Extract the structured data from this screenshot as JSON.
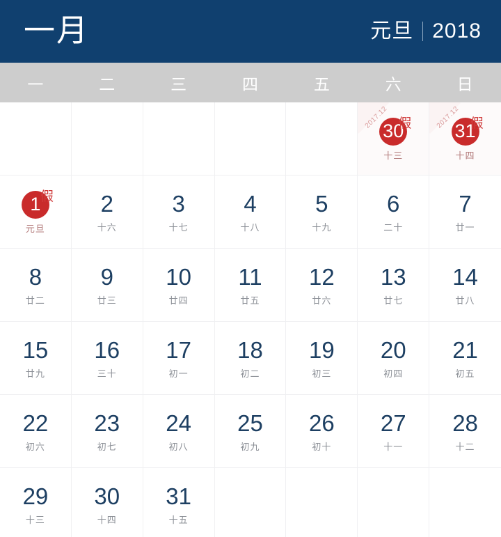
{
  "header": {
    "month_label": "一月",
    "festival_label": "元旦",
    "year_label": "2018",
    "background_color": "#10406f",
    "text_color": "#ffffff"
  },
  "weekdays": {
    "background_color": "#cdcdcd",
    "items": [
      {
        "label": "一"
      },
      {
        "label": "二"
      },
      {
        "label": "三"
      },
      {
        "label": "四"
      },
      {
        "label": "五"
      },
      {
        "label": "六"
      },
      {
        "label": "日"
      }
    ]
  },
  "colors": {
    "navy": "#10406f",
    "day_number": "#1d3f62",
    "lunar_text": "#8b8f96",
    "holiday_red": "#c92b2b",
    "holiday_badge_red": "#cf3b3b",
    "corner_tag_text": "#d99a9a",
    "grid_line": "#eff0f2"
  },
  "weeks": [
    [
      {
        "empty": true
      },
      {
        "empty": true
      },
      {
        "empty": true
      },
      {
        "empty": true
      },
      {
        "empty": true
      },
      {
        "day": "30",
        "lunar": "十三",
        "holiday": true,
        "badge": "假",
        "corner_tag": "2017.12",
        "prev_month": true
      },
      {
        "day": "31",
        "lunar": "十四",
        "holiday": true,
        "badge": "假",
        "corner_tag": "2017.12",
        "prev_month": true
      }
    ],
    [
      {
        "day": "1",
        "lunar": "元旦",
        "holiday": true,
        "badge": "假"
      },
      {
        "day": "2",
        "lunar": "十六"
      },
      {
        "day": "3",
        "lunar": "十七"
      },
      {
        "day": "4",
        "lunar": "十八"
      },
      {
        "day": "5",
        "lunar": "十九"
      },
      {
        "day": "6",
        "lunar": "二十"
      },
      {
        "day": "7",
        "lunar": "廿一"
      }
    ],
    [
      {
        "day": "8",
        "lunar": "廿二"
      },
      {
        "day": "9",
        "lunar": "廿三"
      },
      {
        "day": "10",
        "lunar": "廿四"
      },
      {
        "day": "11",
        "lunar": "廿五"
      },
      {
        "day": "12",
        "lunar": "廿六"
      },
      {
        "day": "13",
        "lunar": "廿七"
      },
      {
        "day": "14",
        "lunar": "廿八"
      }
    ],
    [
      {
        "day": "15",
        "lunar": "廿九"
      },
      {
        "day": "16",
        "lunar": "三十"
      },
      {
        "day": "17",
        "lunar": "初一"
      },
      {
        "day": "18",
        "lunar": "初二"
      },
      {
        "day": "19",
        "lunar": "初三"
      },
      {
        "day": "20",
        "lunar": "初四"
      },
      {
        "day": "21",
        "lunar": "初五"
      }
    ],
    [
      {
        "day": "22",
        "lunar": "初六"
      },
      {
        "day": "23",
        "lunar": "初七"
      },
      {
        "day": "24",
        "lunar": "初八"
      },
      {
        "day": "25",
        "lunar": "初九"
      },
      {
        "day": "26",
        "lunar": "初十"
      },
      {
        "day": "27",
        "lunar": "十一"
      },
      {
        "day": "28",
        "lunar": "十二"
      }
    ],
    [
      {
        "day": "29",
        "lunar": "十三"
      },
      {
        "day": "30",
        "lunar": "十四"
      },
      {
        "day": "31",
        "lunar": "十五"
      },
      {
        "empty": true
      },
      {
        "empty": true
      },
      {
        "empty": true
      },
      {
        "empty": true
      }
    ]
  ]
}
